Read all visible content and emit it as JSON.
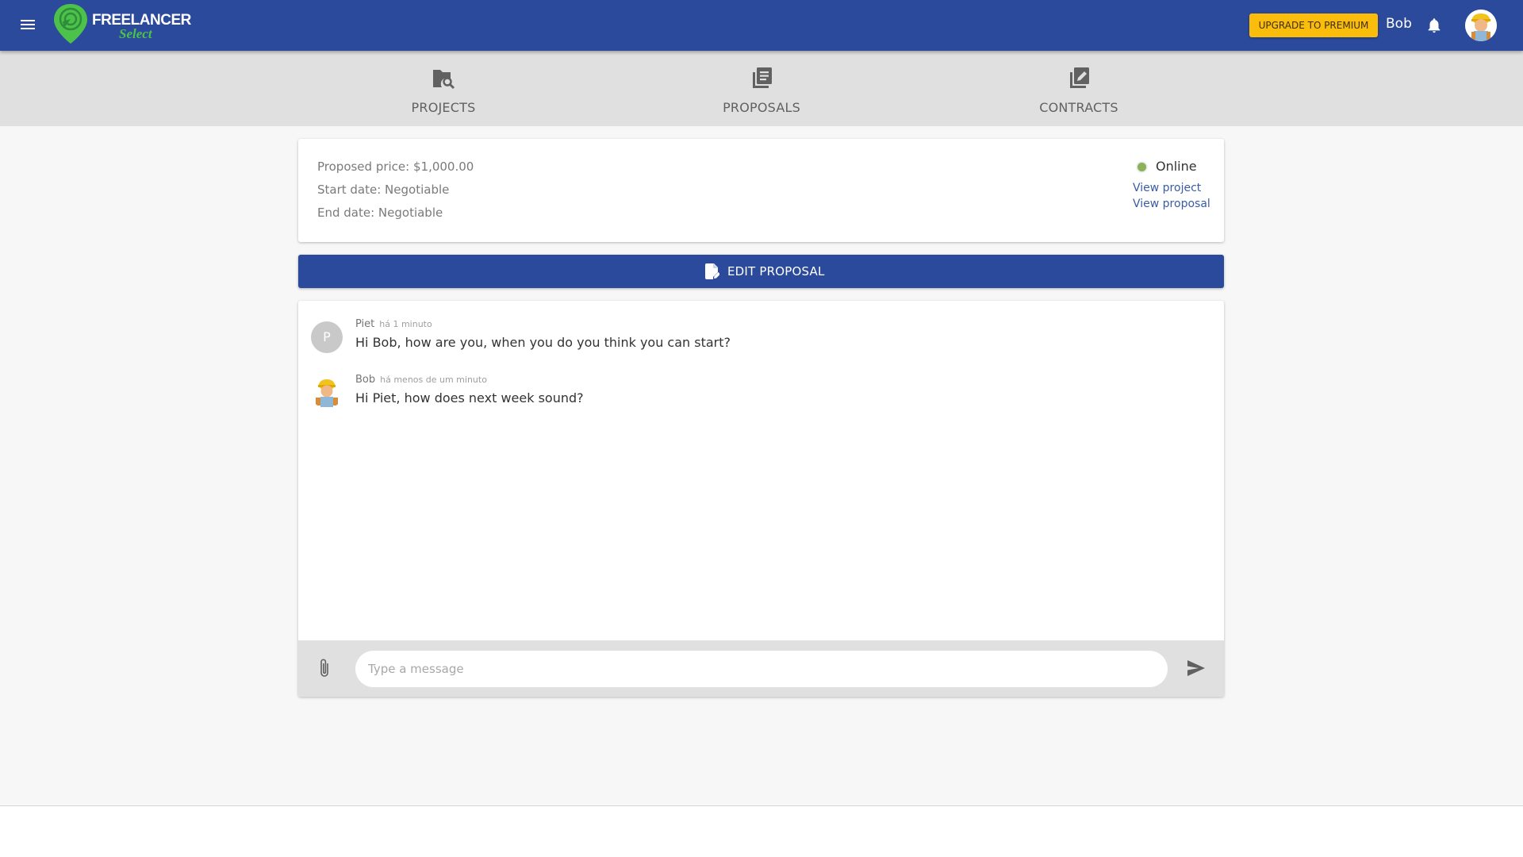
{
  "header": {
    "logo_text": "FREELANCER",
    "logo_subtext": "Select",
    "upgrade_label": "UPGRADE TO PREMIUM",
    "user_name": "Bob",
    "icons": {
      "menu": "hamburger-menu-icon",
      "bell": "notification-bell-icon",
      "avatar": "user-avatar"
    },
    "brand_color": "#2c4a9c",
    "upgrade_color": "#fbbd0c"
  },
  "tabs": [
    {
      "label": "PROJECTS",
      "icon": "folder-search-icon"
    },
    {
      "label": "PROPOSALS",
      "icon": "document-list-icon"
    },
    {
      "label": "CONTRACTS",
      "icon": "edit-document-icon"
    }
  ],
  "proposal": {
    "price_line": "Proposed price: $1,000.00",
    "start_line": "Start date: Negotiable",
    "end_line": "End date: Negotiable",
    "status": "Online",
    "status_color": "#8bb25a",
    "view_project": "View project",
    "view_proposal": "View proposal"
  },
  "edit_button": {
    "label": "EDIT PROPOSAL",
    "icon": "edit-file-icon"
  },
  "chat": {
    "messages": [
      {
        "author": "Piet",
        "avatar_letter": "P",
        "time": "há 1 minuto",
        "text": "Hi Bob, how are you, when you do you think you can start?"
      },
      {
        "author": "Bob",
        "avatar_letter": "",
        "time": "há menos de um minuto",
        "text": "Hi Piet, how does next week sound?"
      }
    ],
    "input_placeholder": "Type a message",
    "input_value": ""
  }
}
